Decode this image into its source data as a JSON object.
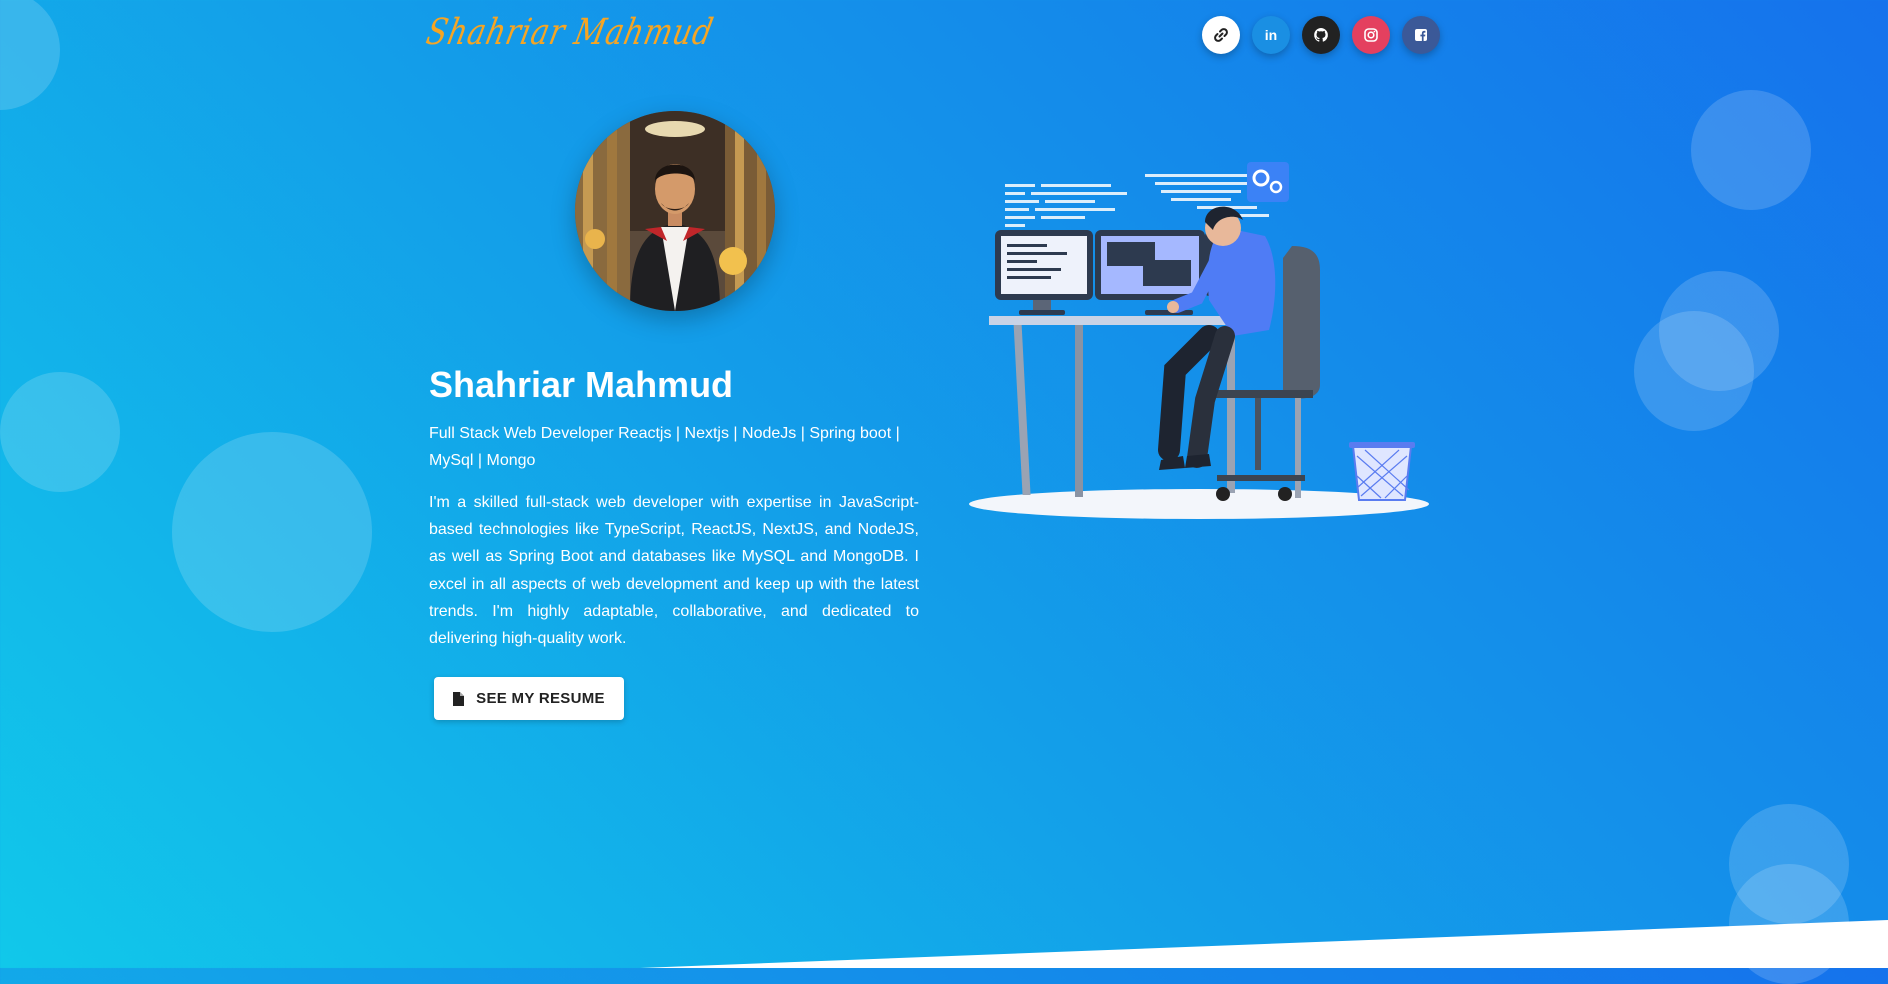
{
  "header": {
    "signature": "Shahriar Mahmud",
    "socials": [
      {
        "name": "link",
        "icon": "link-icon",
        "bg": "#ffffff",
        "fg": "#222222"
      },
      {
        "name": "linkedin",
        "icon": "linkedin-icon",
        "label": "in",
        "bg": "#1a8fe3",
        "fg": "#ffffff"
      },
      {
        "name": "github",
        "icon": "github-icon",
        "bg": "#222222",
        "fg": "#ffffff"
      },
      {
        "name": "instagram",
        "icon": "instagram-icon",
        "bg": "#e4405f",
        "fg": "#ffffff"
      },
      {
        "name": "facebook",
        "icon": "facebook-icon",
        "bg": "#3b5998",
        "fg": "#ffffff"
      }
    ]
  },
  "hero": {
    "name": "Shahriar Mahmud",
    "role": "Full Stack Web Developer Reactjs | Nextjs | NodeJs | Spring boot | MySql | Mongo",
    "bio": "I'm a skilled full-stack web developer with expertise in JavaScript-based technologies like TypeScript, ReactJS, NextJS, and NodeJS, as well as Spring Boot and databases like MySQL and MongoDB. I excel in all aspects of web development and keep up with the latest trends. I'm highly adaptable, collaborative, and dedicated to delivering high-quality work.",
    "resume_button": "SEE MY RESUME"
  },
  "colors": {
    "signature": "#f5a524",
    "background_start": "#11c8ea",
    "background_end": "#1572ec"
  }
}
